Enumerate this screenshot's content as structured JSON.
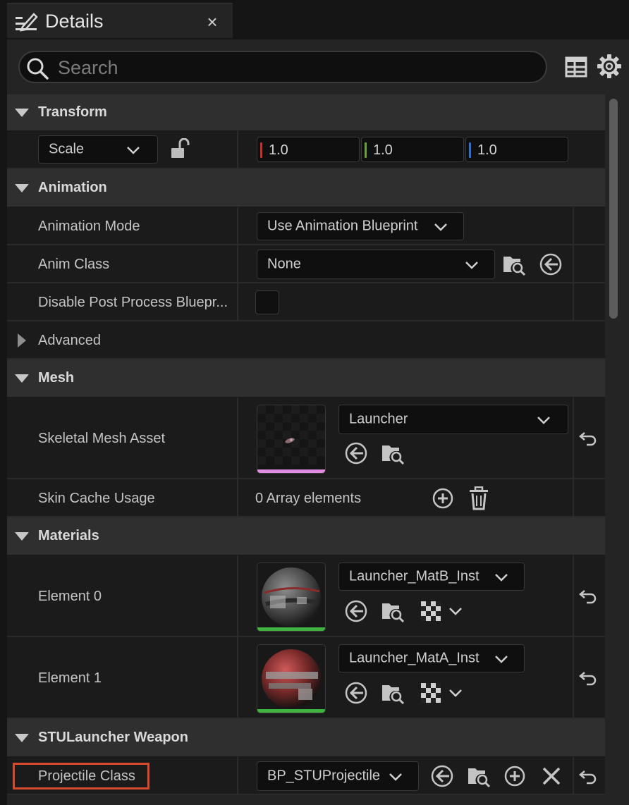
{
  "tab": {
    "title": "Details",
    "close_glyph": "×",
    "icon": "edit-icon"
  },
  "search": {
    "placeholder": "Search",
    "value": ""
  },
  "toolbar": {
    "table_icon": "table-view-icon",
    "settings_icon": "gear-icon"
  },
  "transform": {
    "header": "Transform",
    "scale_combo": "Scale",
    "lock_icon": "unlock-icon",
    "x": "1.0",
    "y": "1.0",
    "z": "1.0",
    "axis_colors": {
      "x": "#c8302c",
      "y": "#6aa42b",
      "z": "#2f6ed3"
    }
  },
  "animation": {
    "header": "Animation",
    "mode_label": "Animation Mode",
    "mode_value": "Use Animation Blueprint",
    "class_label": "Anim Class",
    "class_value": "None",
    "disable_label": "Disable Post Process Bluepr...",
    "disable_checked": false,
    "advanced_label": "Advanced"
  },
  "mesh": {
    "header": "Mesh",
    "asset_label": "Skeletal Mesh Asset",
    "asset_value": "Launcher",
    "asset_stripe_color": "#e08ce0",
    "skin_label": "Skin Cache Usage",
    "skin_value": "0 Array elements"
  },
  "materials": {
    "header": "Materials",
    "elements": [
      {
        "label": "Element 0",
        "value": "Launcher_MatB_Inst",
        "stripe_color": "#3fb33f"
      },
      {
        "label": "Element 1",
        "value": "Launcher_MatA_Inst",
        "stripe_color": "#3fb33f"
      }
    ]
  },
  "weapon": {
    "header": "STULauncher Weapon",
    "projectile_label": "Projectile Class",
    "projectile_value": "BP_STUProjectile",
    "highlight_color": "#d84a2e"
  }
}
